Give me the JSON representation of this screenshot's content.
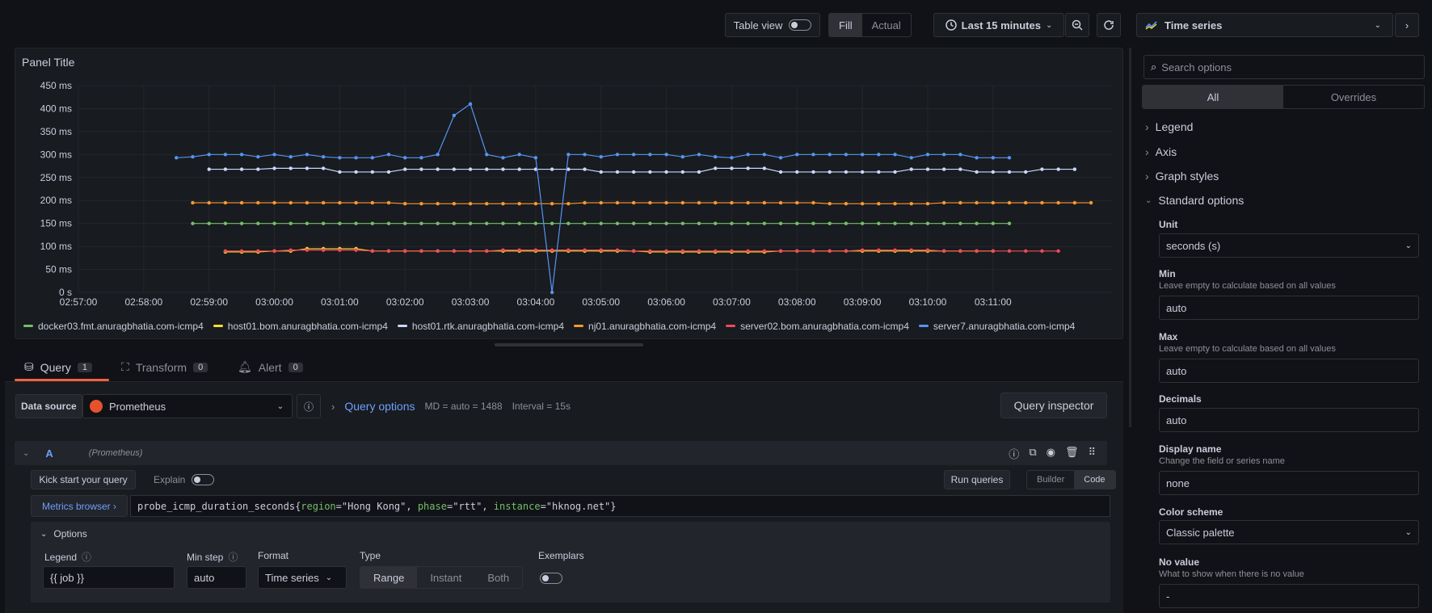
{
  "toolbar": {
    "table_view": "Table view",
    "fill": "Fill",
    "actual": "Actual",
    "time_range": "Last 15 minutes",
    "viz_type": "Time series"
  },
  "panel": {
    "title": "Panel Title"
  },
  "chart_data": {
    "type": "line",
    "y_ticks": [
      "450 ms",
      "400 ms",
      "350 ms",
      "300 ms",
      "250 ms",
      "200 ms",
      "150 ms",
      "100 ms",
      "50 ms",
      "0 s"
    ],
    "x_ticks": [
      "02:57:00",
      "02:58:00",
      "02:59:00",
      "03:00:00",
      "03:01:00",
      "03:02:00",
      "03:03:00",
      "03:04:00",
      "03:05:00",
      "03:06:00",
      "03:07:00",
      "03:08:00",
      "03:09:00",
      "03:10:00",
      "03:11:00"
    ],
    "ylim": [
      0,
      450
    ],
    "y_unit": "ms",
    "grid": true,
    "legend_placement": "bottom",
    "x_start": "02:58:30",
    "x_step_seconds": 15,
    "series": [
      {
        "name": "docker03.fmt.anuragbhatia.com-icmp4",
        "color": "#73bf69",
        "start": "02:58:45",
        "values": [
          150,
          150,
          150,
          150,
          150,
          150,
          150,
          150,
          150,
          150,
          150,
          150,
          150,
          150,
          150,
          150,
          150,
          150,
          150,
          150,
          150,
          150,
          150,
          150,
          150,
          150,
          150,
          150,
          150,
          150,
          150,
          150,
          150,
          150,
          150,
          150,
          150,
          150,
          150,
          150,
          150,
          150,
          150,
          150,
          150,
          150,
          150,
          150,
          150,
          150,
          150
        ]
      },
      {
        "name": "host01.bom.anuragbhatia.com-icmp4",
        "color": "#fade2a",
        "start": "02:59:15",
        "values": [
          88,
          88,
          88,
          90,
          90,
          95,
          95,
          95,
          95,
          90,
          90,
          90,
          90,
          90,
          90,
          90,
          90,
          90,
          90,
          90,
          90,
          90,
          90,
          90,
          90,
          90,
          88,
          88,
          88,
          88,
          88,
          88,
          88,
          88,
          90,
          90,
          90,
          90,
          90,
          90,
          90,
          90,
          90,
          90,
          90,
          90,
          90,
          90
        ]
      },
      {
        "name": "host01.rtk.anuragbhatia.com-icmp4",
        "color": "#c8d8ff",
        "start": "02:59:00",
        "values": [
          268,
          268,
          268,
          268,
          270,
          270,
          270,
          270,
          262,
          262,
          262,
          262,
          268,
          268,
          268,
          268,
          268,
          268,
          268,
          268,
          268,
          268,
          268,
          268,
          262,
          262,
          262,
          262,
          262,
          262,
          262,
          270,
          270,
          270,
          270,
          262,
          262,
          262,
          262,
          262,
          262,
          262,
          262,
          268,
          268,
          268,
          268,
          262,
          262,
          262,
          262,
          268,
          268,
          268
        ]
      },
      {
        "name": "nj01.anuragbhatia.com-icmp4",
        "color": "#ff9830",
        "start": "02:58:45",
        "values": [
          195,
          195,
          195,
          195,
          195,
          195,
          195,
          195,
          195,
          195,
          195,
          195,
          195,
          193,
          193,
          193,
          193,
          193,
          193,
          193,
          193,
          193,
          193,
          193,
          195,
          195,
          195,
          195,
          195,
          195,
          195,
          195,
          195,
          195,
          195,
          195,
          195,
          195,
          195,
          193,
          193,
          193,
          193,
          193,
          193,
          193,
          195,
          195,
          195,
          195,
          195,
          195,
          195,
          195,
          195,
          195
        ]
      },
      {
        "name": "server02.bom.anuragbhatia.com-icmp4",
        "color": "#f2495c",
        "start": "02:59:15",
        "values": [
          90,
          90,
          90,
          90,
          92,
          92,
          92,
          92,
          92,
          90,
          90,
          90,
          90,
          90,
          90,
          90,
          90,
          92,
          92,
          92,
          92,
          92,
          92,
          92,
          92,
          90,
          90,
          90,
          90,
          90,
          90,
          90,
          90,
          90,
          90,
          90,
          90,
          90,
          90,
          92,
          92,
          92,
          92,
          92,
          90,
          90,
          90,
          90,
          90,
          90,
          90,
          90
        ]
      },
      {
        "name": "server7.anuragbhatia.com-icmp4",
        "color": "#5794f2",
        "start": "02:58:30",
        "values": [
          293,
          295,
          300,
          300,
          300,
          295,
          300,
          295,
          300,
          295,
          293,
          293,
          293,
          300,
          293,
          293,
          300,
          385,
          410,
          300,
          293,
          300,
          293,
          0,
          300,
          300,
          295,
          300,
          300,
          300,
          300,
          295,
          300,
          295,
          293,
          300,
          300,
          293,
          300,
          300,
          300,
          300,
          300,
          300,
          300,
          293,
          300,
          300,
          300,
          293,
          293,
          293
        ]
      }
    ]
  },
  "tabs": [
    {
      "label": "Query",
      "count": "1"
    },
    {
      "label": "Transform",
      "count": "0"
    },
    {
      "label": "Alert",
      "count": "0"
    }
  ],
  "query": {
    "data_source_label": "Data source",
    "data_source": "Prometheus",
    "query_options": "Query options",
    "md": "MD = auto = 1488",
    "interval": "Interval = 15s",
    "query_inspector": "Query inspector",
    "row_letter": "A",
    "row_source": "(Prometheus)",
    "kick_start": "Kick start your query",
    "explain": "Explain",
    "run_queries": "Run queries",
    "builder": "Builder",
    "code": "Code",
    "metrics_browser": "Metrics browser ›",
    "expr_metric": "probe_icmp_duration_seconds{",
    "expr_k1": "region",
    "expr_v1": "\"Hong Kong\"",
    "expr_k2": "phase",
    "expr_v2": "\"rtt\"",
    "expr_k3": "instance",
    "expr_v3": "\"hknog.net\"",
    "options_label": "Options",
    "legend_label": "Legend",
    "legend_value": "{{ job }}",
    "min_step_label": "Min step",
    "min_step_placeholder": "auto",
    "format_label": "Format",
    "format_value": "Time series",
    "type_label": "Type",
    "type_range": "Range",
    "type_instant": "Instant",
    "type_both": "Both",
    "exemplars_label": "Exemplars"
  },
  "options_pane": {
    "search_placeholder": "Search options",
    "all": "All",
    "overrides": "Overrides",
    "sections": [
      "Legend",
      "Axis",
      "Graph styles",
      "Standard options"
    ],
    "unit_label": "Unit",
    "unit_value": "seconds (s)",
    "min_label": "Min",
    "min_desc": "Leave empty to calculate based on all values",
    "min_placeholder": "auto",
    "max_label": "Max",
    "max_desc": "Leave empty to calculate based on all values",
    "max_placeholder": "auto",
    "decimals_label": "Decimals",
    "decimals_placeholder": "auto",
    "display_name_label": "Display name",
    "display_name_desc": "Change the field or series name",
    "display_name_placeholder": "none",
    "color_scheme_label": "Color scheme",
    "color_scheme_value": "Classic palette",
    "no_value_label": "No value",
    "no_value_desc": "What to show when there is no value",
    "no_value_placeholder": "-"
  }
}
